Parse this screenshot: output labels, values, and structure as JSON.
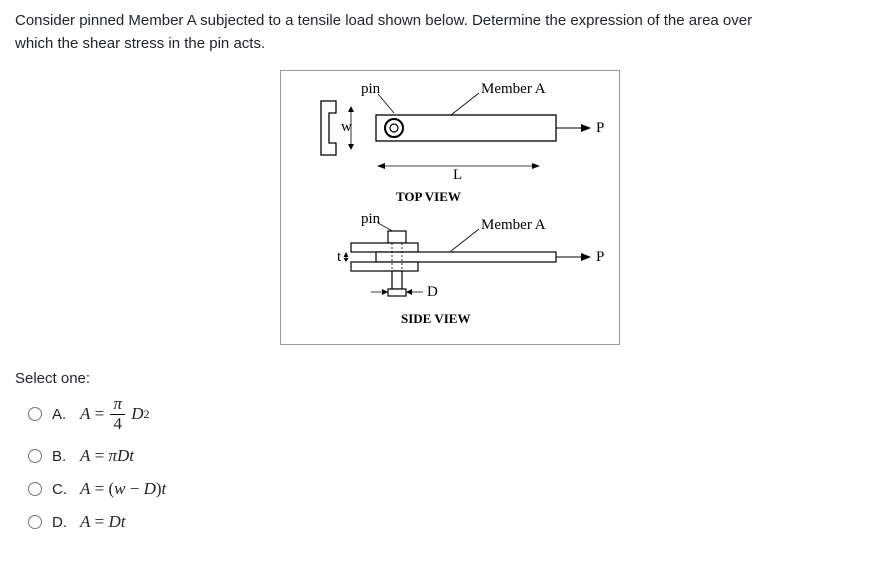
{
  "question": {
    "line1": "Consider pinned Member A subjected to a tensile load shown below. Determine the expression of the area over",
    "line2": "which the shear stress in the pin acts."
  },
  "figure": {
    "top": {
      "pin": "pin",
      "memberA": "Member A",
      "P": "P",
      "w": "w",
      "L": "L",
      "caption": "TOP VIEW"
    },
    "side": {
      "pin": "pin",
      "memberA": "Member A",
      "P": "P",
      "t": "t",
      "D": "D",
      "caption": "SIDE VIEW"
    }
  },
  "select_label": "Select one:",
  "options": {
    "a": {
      "letter": "A."
    },
    "b": {
      "letter": "B."
    },
    "c": {
      "letter": "C."
    },
    "d": {
      "letter": "D."
    }
  }
}
